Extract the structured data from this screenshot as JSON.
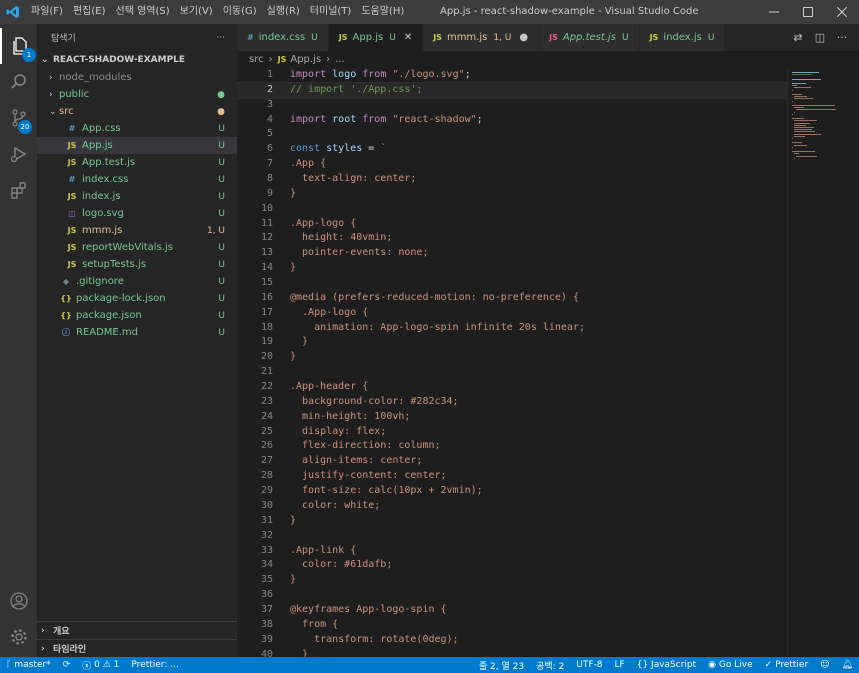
{
  "titlebar": {
    "menu": [
      "파일(F)",
      "편집(E)",
      "선택 영역(S)",
      "보기(V)",
      "이동(G)",
      "실행(R)",
      "터미널(T)",
      "도움말(H)"
    ],
    "window_title": "App.js - react-shadow-example - Visual Studio Code"
  },
  "activity": {
    "explorer_badge": "1",
    "scm_badge": "20"
  },
  "sidebar": {
    "header": "탐색기",
    "more": "···",
    "section": "REACT-SHADOW-EXAMPLE",
    "tree": [
      {
        "indent": 0,
        "chev": "›",
        "icon": "",
        "name": "node_modules",
        "status": "",
        "cls": "c-gray",
        "scls": ""
      },
      {
        "indent": 0,
        "chev": "›",
        "icon": "",
        "name": "public",
        "status": "●",
        "cls": "c-green",
        "scls": "c-git"
      },
      {
        "indent": 0,
        "chev": "⌄",
        "icon": "",
        "name": "src",
        "status": "●",
        "cls": "c-yellow",
        "scls": "c-yellow"
      },
      {
        "indent": 1,
        "chev": "",
        "icon": "#",
        "iconcolor": "#519aba",
        "name": "App.css",
        "status": "U",
        "cls": "c-green",
        "scls": "c-green"
      },
      {
        "indent": 1,
        "chev": "",
        "icon": "JS",
        "iconcolor": "#cbcb41",
        "name": "App.js",
        "status": "U",
        "cls": "c-green",
        "scls": "c-green",
        "selected": true
      },
      {
        "indent": 1,
        "chev": "",
        "icon": "JS",
        "iconcolor": "#cbcb41",
        "name": "App.test.js",
        "status": "U",
        "cls": "c-green",
        "scls": "c-green"
      },
      {
        "indent": 1,
        "chev": "",
        "icon": "#",
        "iconcolor": "#519aba",
        "name": "index.css",
        "status": "U",
        "cls": "c-green",
        "scls": "c-green"
      },
      {
        "indent": 1,
        "chev": "",
        "icon": "JS",
        "iconcolor": "#cbcb41",
        "name": "index.js",
        "status": "U",
        "cls": "c-green",
        "scls": "c-green"
      },
      {
        "indent": 1,
        "chev": "",
        "icon": "◫",
        "iconcolor": "#a074c4",
        "name": "logo.svg",
        "status": "U",
        "cls": "c-green",
        "scls": "c-green"
      },
      {
        "indent": 1,
        "chev": "",
        "icon": "JS",
        "iconcolor": "#cbcb41",
        "name": "mmm.js",
        "status": "1, U",
        "cls": "c-yellow",
        "scls": "c-yellow"
      },
      {
        "indent": 1,
        "chev": "",
        "icon": "JS",
        "iconcolor": "#cbcb41",
        "name": "reportWebVitals.js",
        "status": "U",
        "cls": "c-green",
        "scls": "c-green"
      },
      {
        "indent": 1,
        "chev": "",
        "icon": "JS",
        "iconcolor": "#cbcb41",
        "name": "setupTests.js",
        "status": "U",
        "cls": "c-green",
        "scls": "c-green"
      },
      {
        "indent": 0,
        "chev": "",
        "icon": "◆",
        "iconcolor": "#6d8086",
        "name": ".gitignore",
        "status": "U",
        "cls": "c-green",
        "scls": "c-green"
      },
      {
        "indent": 0,
        "chev": "",
        "icon": "{}",
        "iconcolor": "#cbcb41",
        "name": "package-lock.json",
        "status": "U",
        "cls": "c-green",
        "scls": "c-green"
      },
      {
        "indent": 0,
        "chev": "",
        "icon": "{}",
        "iconcolor": "#cbcb41",
        "name": "package.json",
        "status": "U",
        "cls": "c-green",
        "scls": "c-green"
      },
      {
        "indent": 0,
        "chev": "",
        "icon": "ⓘ",
        "iconcolor": "#519aba",
        "name": "README.md",
        "status": "U",
        "cls": "c-green",
        "scls": "c-green"
      }
    ],
    "outline": "개요",
    "timeline": "타임라인"
  },
  "tabs": [
    {
      "icon": "#",
      "iconcolor": "#519aba",
      "label": "index.css",
      "status": "U",
      "cls": "c-green",
      "active": false,
      "italic": false
    },
    {
      "icon": "JS",
      "iconcolor": "#cbcb41",
      "label": "App.js",
      "status": "U",
      "cls": "c-green",
      "active": true,
      "italic": false,
      "close": "✕"
    },
    {
      "icon": "JS",
      "iconcolor": "#cbcb41",
      "label": "mmm.js",
      "status": "1, U",
      "cls": "c-yellow",
      "active": false,
      "italic": false,
      "dot": "●"
    },
    {
      "icon": "JS",
      "iconcolor": "#f55385",
      "label": "App.test.js",
      "status": "U",
      "cls": "c-green",
      "active": false,
      "italic": true
    },
    {
      "icon": "JS",
      "iconcolor": "#cbcb41",
      "label": "index.js",
      "status": "U",
      "cls": "c-green",
      "active": false,
      "italic": false
    }
  ],
  "breadcrumb": {
    "folder": "src",
    "file": "App.js",
    "more": "..."
  },
  "code": [
    [
      [
        "kw",
        "import "
      ],
      [
        "var",
        "logo"
      ],
      [
        "kw",
        " from "
      ],
      [
        "str",
        "\"./logo.svg\""
      ],
      [
        "",
        ";"
      ]
    ],
    [
      [
        "cmt",
        "// import './App.css';"
      ]
    ],
    [],
    [
      [
        "kw",
        "import "
      ],
      [
        "var",
        "root"
      ],
      [
        "kw",
        " from "
      ],
      [
        "str",
        "\"react-shadow\""
      ],
      [
        "",
        ";"
      ]
    ],
    [],
    [
      [
        "kw2",
        "const "
      ],
      [
        "var",
        "styles"
      ],
      [
        "",
        " = "
      ],
      [
        "str",
        "`"
      ]
    ],
    [
      [
        "str",
        ".App {"
      ]
    ],
    [
      [
        "str",
        "  text-align: center;"
      ]
    ],
    [
      [
        "str",
        "}"
      ]
    ],
    [],
    [
      [
        "str",
        ".App-logo {"
      ]
    ],
    [
      [
        "str",
        "  height: 40vmin;"
      ]
    ],
    [
      [
        "str",
        "  pointer-events: none;"
      ]
    ],
    [
      [
        "str",
        "}"
      ]
    ],
    [],
    [
      [
        "str",
        "@media (prefers-reduced-motion: no-preference) {"
      ]
    ],
    [
      [
        "str",
        "  .App-logo {"
      ]
    ],
    [
      [
        "str",
        "    animation: App-logo-spin infinite 20s linear;"
      ]
    ],
    [
      [
        "str",
        "  }"
      ]
    ],
    [
      [
        "str",
        "}"
      ]
    ],
    [],
    [
      [
        "str",
        ".App-header {"
      ]
    ],
    [
      [
        "str",
        "  background-color: #282c34;"
      ]
    ],
    [
      [
        "str",
        "  min-height: 100vh;"
      ]
    ],
    [
      [
        "str",
        "  display: flex;"
      ]
    ],
    [
      [
        "str",
        "  flex-direction: column;"
      ]
    ],
    [
      [
        "str",
        "  align-items: center;"
      ]
    ],
    [
      [
        "str",
        "  justify-content: center;"
      ]
    ],
    [
      [
        "str",
        "  font-size: calc(10px + 2vmin);"
      ]
    ],
    [
      [
        "str",
        "  color: white;"
      ]
    ],
    [
      [
        "str",
        "}"
      ]
    ],
    [],
    [
      [
        "str",
        ".App-link {"
      ]
    ],
    [
      [
        "str",
        "  color: #61dafb;"
      ]
    ],
    [
      [
        "str",
        "}"
      ]
    ],
    [],
    [
      [
        "str",
        "@keyframes App-logo-spin {"
      ]
    ],
    [
      [
        "str",
        "  from {"
      ]
    ],
    [
      [
        "str",
        "    transform: rotate(0deg);"
      ]
    ],
    [
      [
        "str",
        "  }"
      ]
    ]
  ],
  "current_line": 2,
  "statusbar": {
    "branch": "master*",
    "errors": "0",
    "warnings": "1",
    "prettier_left": "Prettier: ...",
    "position": "줄 2, 열 23",
    "spaces": "공백: 2",
    "encoding": "UTF-8",
    "eol": "LF",
    "language": "JavaScript",
    "golive": "Go Live",
    "prettier": "Prettier"
  }
}
